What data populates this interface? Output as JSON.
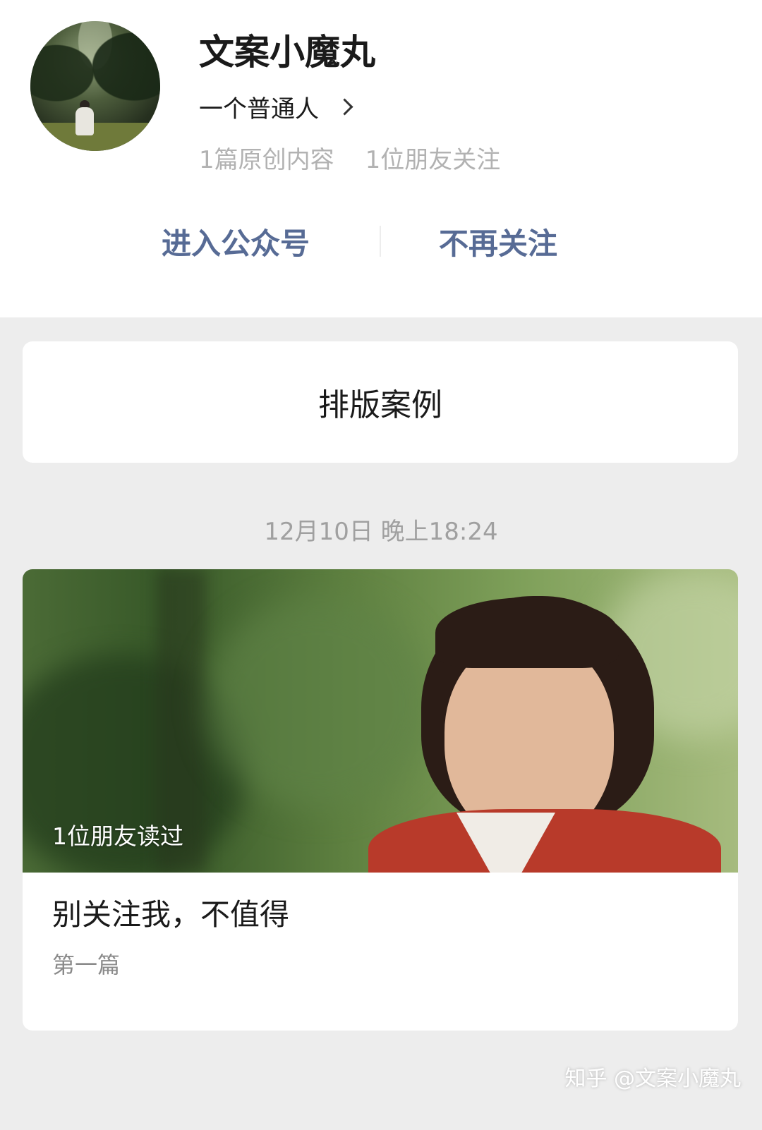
{
  "profile": {
    "name": "文案小魔丸",
    "subtitle": "一个普通人",
    "original_count": "1篇原创内容",
    "friends_follow": "1位朋友关注"
  },
  "actions": {
    "enter": "进入公众号",
    "unfollow": "不再关注"
  },
  "collection": {
    "label": "排版案例"
  },
  "feed": {
    "date": "12月10日 晚上18:24",
    "article": {
      "read_badge": "1位朋友读过",
      "title": "别关注我，不值得",
      "subtitle": "第一篇"
    }
  },
  "watermark": "知乎 @文案小魔丸",
  "colors": {
    "link": "#576b95",
    "background": "#ededed",
    "muted": "#b2b2b2"
  }
}
